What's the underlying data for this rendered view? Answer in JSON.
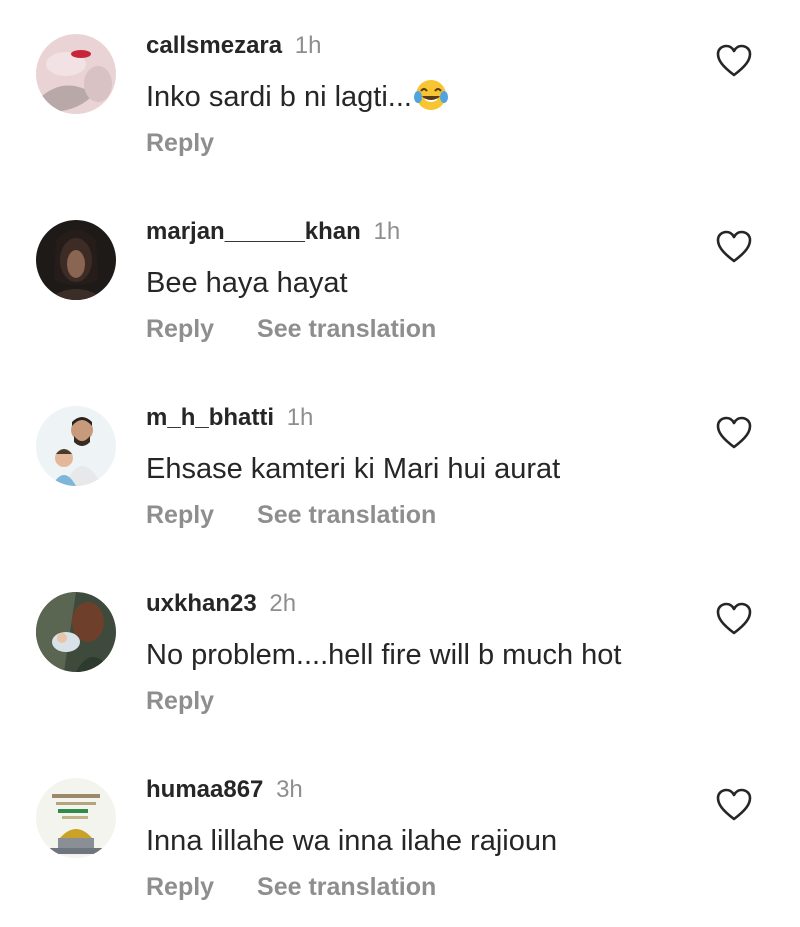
{
  "comments": [
    {
      "username": "callsmezara",
      "time": "1h",
      "text": "Inko sardi b ni lagti...",
      "emoji": "face-with-tears-of-joy",
      "reply_label": "Reply",
      "translation_label": ""
    },
    {
      "username": "marjan______khan",
      "time": "1h",
      "text": "Bee haya hayat",
      "reply_label": "Reply",
      "translation_label": "See translation"
    },
    {
      "username": "m_h_bhatti",
      "time": "1h",
      "text": "Ehsase kamteri ki Mari hui aurat",
      "reply_label": "Reply",
      "translation_label": "See translation"
    },
    {
      "username": "uxkhan23",
      "time": "2h",
      "text": "No problem....hell fire will b much hot",
      "reply_label": "Reply",
      "translation_label": ""
    },
    {
      "username": "humaa867",
      "time": "3h",
      "text": "Inna lillahe wa inna ilahe rajioun",
      "reply_label": "Reply",
      "translation_label": "See translation"
    }
  ],
  "icons": {
    "like": "heart-outline-icon",
    "emoji": "face-with-tears-of-joy"
  },
  "colors": {
    "text": "#262626",
    "secondary": "#8e8e8e"
  }
}
